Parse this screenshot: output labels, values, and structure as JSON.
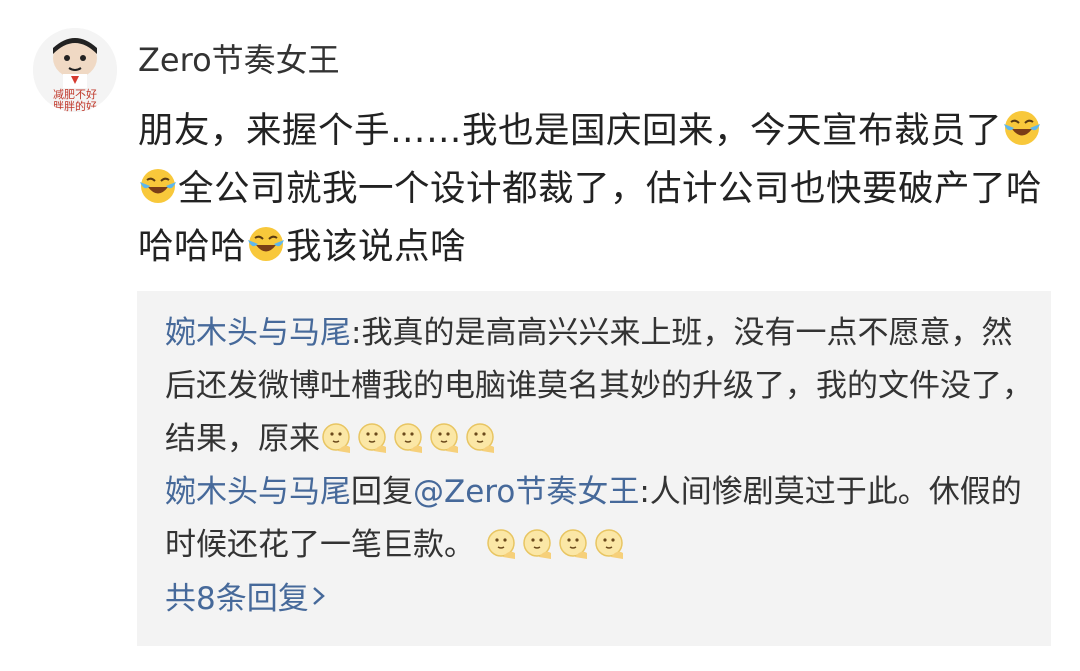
{
  "post": {
    "username": "Zero节奏女王",
    "avatar_text": [
      "减肥不好",
      "胖胖的好"
    ],
    "comment": {
      "part1": "朋友，来握个手……我也是国庆回来，今天宣布裁员了",
      "part2": "全公司就我一个设计都裁了，估计公司也快要破产了哈哈哈哈",
      "part3": "我该说点啥"
    }
  },
  "replies": [
    {
      "author": "婉木头与马尾",
      "text": ":我真的是高高兴兴来上班，没有一点不愿意，然后还发微博吐槽我的电脑谁莫名其妙的升级了，我的文件没了，结果，原来"
    },
    {
      "author": "婉木头与马尾",
      "reply_word": "回复",
      "mention": "@Zero节奏女王",
      "text": ":人间惨剧莫过于此。休假的时候还花了一笔巨款。"
    }
  ],
  "more_replies": "共8条回复",
  "colors": {
    "link": "#46699a",
    "reply_bg": "#f3f3f3",
    "text": "#222222"
  },
  "icons": {
    "laugh_cry": "laugh-cry-emoji",
    "thinking": "thinking-face-emoji",
    "chevron": "chevron-right-icon"
  }
}
